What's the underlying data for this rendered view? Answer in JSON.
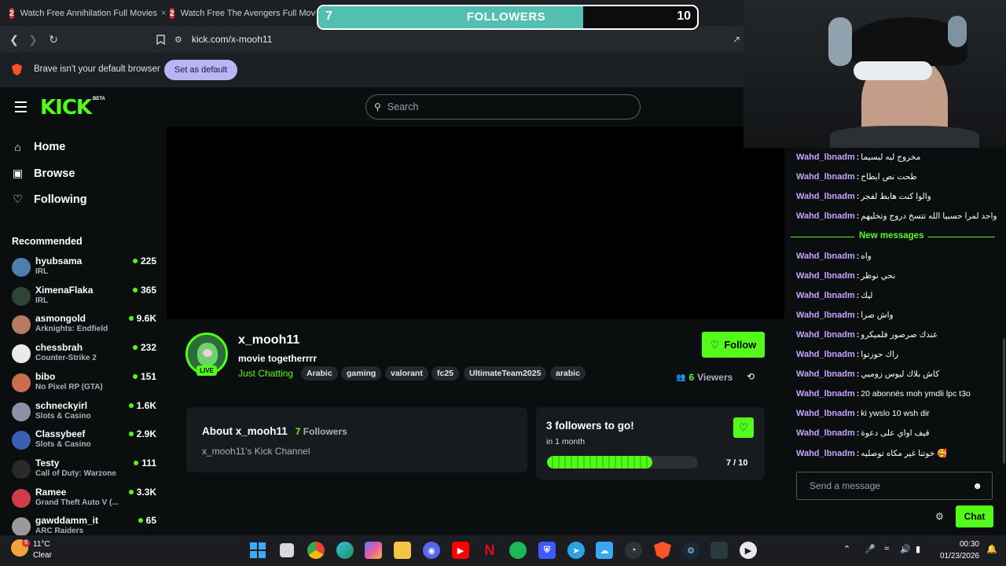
{
  "browser": {
    "tabs": [
      {
        "title": "Watch Free Annihilation Full Movies"
      },
      {
        "title": "Watch Free The Avengers Full Movies"
      }
    ],
    "url": "kick.com/x-mooh11",
    "infobar": {
      "message": "Brave isn't your default browser",
      "button": "Set as default"
    }
  },
  "overlay": {
    "follower_goal": {
      "current": "7",
      "label": "FOLLOWERS",
      "target": "10",
      "progress": 0.7
    }
  },
  "kick": {
    "logo": "KICK",
    "logo_badge": "BETA",
    "search_placeholder": "Search",
    "nav": [
      {
        "label": "Home",
        "icon": "home-icon"
      },
      {
        "label": "Browse",
        "icon": "browse-icon"
      },
      {
        "label": "Following",
        "icon": "heart-icon"
      }
    ],
    "recommended_title": "Recommended",
    "recommended": [
      {
        "name": "hyubsama",
        "category": "IRL",
        "viewers": "225",
        "color": "#4a7fb0"
      },
      {
        "name": "XimenaFlaka",
        "category": "IRL",
        "viewers": "365",
        "color": "#2e4636"
      },
      {
        "name": "asmongold",
        "category": "Arknights: Endfield",
        "viewers": "9.6K",
        "color": "#b87b62"
      },
      {
        "name": "chessbrah",
        "category": "Counter-Strike 2",
        "viewers": "232",
        "color": "#e9e9e9"
      },
      {
        "name": "bibo",
        "category": "No Pixel RP (GTA)",
        "viewers": "151",
        "color": "#c96d4f"
      },
      {
        "name": "schneckyirl",
        "category": "Slots & Casino",
        "viewers": "1.6K",
        "color": "#8c8fa8"
      },
      {
        "name": "Classybeef",
        "category": "Slots & Casino",
        "viewers": "2.9K",
        "color": "#3c5fb4"
      },
      {
        "name": "Testy",
        "category": "Call of Duty: Warzone",
        "viewers": "111",
        "color": "#2a2a2a"
      },
      {
        "name": "Ramee",
        "category": "Grand Theft Auto V (...",
        "viewers": "3.3K",
        "color": "#d13c4c"
      },
      {
        "name": "gawddamm_it",
        "category": "ARC Raiders",
        "viewers": "65",
        "color": "#9a9a9a"
      }
    ],
    "channel": {
      "name": "x_mooh11",
      "title": "movie togetherrrr",
      "category": "Just Chatting",
      "live_badge": "LIVE",
      "tags": [
        "Arabic",
        "gaming",
        "valorant",
        "fc25",
        "UltimateTeam2025",
        "arabic"
      ],
      "follow_label": "Follow",
      "viewers_count": "6",
      "viewers_label": "Viewers"
    },
    "about": {
      "title": "About x_mooh11",
      "followers_count": "7",
      "followers_label": "Followers",
      "description": "x_mooh11's Kick Channel"
    },
    "goal": {
      "title": "3 followers to go!",
      "subtitle": "in 1 month",
      "count": "7 / 10",
      "progress": 0.7
    }
  },
  "chat": {
    "new_messages_label": "New messages",
    "messages_before": [
      {
        "user": "Wahd_lbnadm",
        "text": "مخروج لبه لبسيما"
      },
      {
        "user": "Wahd_lbnadm",
        "text": "طحت نص ايطاح"
      },
      {
        "user": "Wahd_lbnadm",
        "text": "والوا كنت هابط لفجر"
      },
      {
        "user": "Wahd_lbnadm",
        "text": "واحد لمرا حسبيا الله تتسخ دروج وتخليهم"
      }
    ],
    "messages_after": [
      {
        "user": "Wahd_lbnadm",
        "text": "واه"
      },
      {
        "user": "Wahd_lbnadm",
        "text": "نحي نوظر"
      },
      {
        "user": "Wahd_lbnadm",
        "text": "ليك"
      },
      {
        "user": "Wahd_lbnadm",
        "text": "واش صرا"
      },
      {
        "user": "Wahd_lbnadm",
        "text": "عندك صرصور فلميكرو"
      },
      {
        "user": "Wahd_lbnadm",
        "text": "راك حوزتوا"
      },
      {
        "user": "Wahd_lbnadm",
        "text": "كاش بلاك ليوس زوميي"
      },
      {
        "user": "Wahd_lbnadm",
        "text": "20 abonnés moh ymdli lpc t3o"
      },
      {
        "user": "Wahd_lbnadm",
        "text": "ki ywslo 10 wsh dir"
      },
      {
        "user": "Wahd_lbnadm",
        "text": "قيف اواي على دعوة"
      },
      {
        "user": "Wahd_lbnadm",
        "text": "خوتنا غير مكاه توصليه 🥰"
      }
    ],
    "input_placeholder": "Send a message",
    "send_label": "Chat"
  },
  "taskbar": {
    "weather_temp": "11°C",
    "weather_desc": "Clear",
    "weather_badge": "9",
    "time": "00:30",
    "date": "01/23/2026"
  },
  "colors": {
    "accent": "#53fc18",
    "username": "#c7a3ff",
    "panel": "#181b1e"
  }
}
